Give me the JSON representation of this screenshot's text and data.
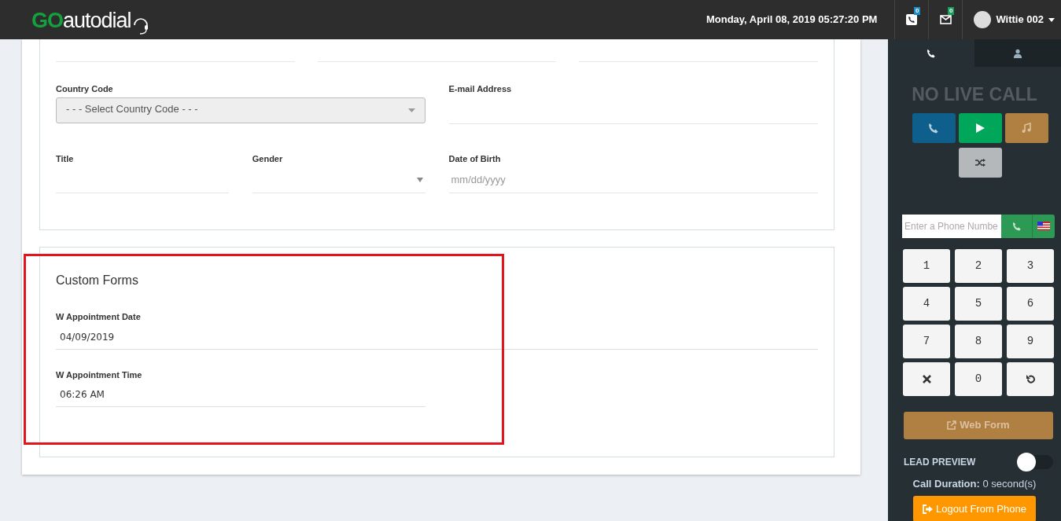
{
  "header": {
    "logo_go": "GO",
    "logo_rest": "autodial",
    "datetime": "Monday, April 08, 2019 05:27:20 PM",
    "calls_badge": "0",
    "messages_badge": "0",
    "user_name": "Wittie 002"
  },
  "contact_form": {
    "fields": [
      {
        "label": "Country Code",
        "kind": "select",
        "value": "- - - Select Country Code - - -"
      },
      {
        "label": "E-mail Address",
        "kind": "text"
      },
      {
        "label": "Title",
        "kind": "text"
      },
      {
        "label": "Gender",
        "kind": "dropdown"
      },
      {
        "label": "Date of Birth",
        "kind": "date",
        "placeholder": "mm/dd/yyyy"
      }
    ]
  },
  "custom_forms": {
    "title": "Custom Forms",
    "highlighted": true,
    "fields": [
      {
        "label": "W Appointment Date",
        "kind": "wide",
        "value": "04/09/2019"
      },
      {
        "label": "W Appointment Time",
        "kind": "half",
        "value": "06:26 AM"
      }
    ]
  },
  "dialer": {
    "tabs": [
      {
        "kind": "phone",
        "selected": true
      },
      {
        "kind": "person",
        "selected": false
      }
    ],
    "status": "NO LIVE CALL",
    "actions": [
      {
        "kind": "call"
      },
      {
        "kind": "play"
      },
      {
        "kind": "music"
      },
      {
        "kind": "shuffle"
      }
    ],
    "phone_input": {
      "placeholder": "Enter a Phone Numbe"
    },
    "keys": [
      {
        "kind": "digit",
        "label": "1"
      },
      {
        "kind": "digit",
        "label": "2"
      },
      {
        "kind": "digit",
        "label": "3"
      },
      {
        "kind": "digit",
        "label": "4"
      },
      {
        "kind": "digit",
        "label": "5"
      },
      {
        "kind": "digit",
        "label": "6"
      },
      {
        "kind": "digit",
        "label": "7"
      },
      {
        "kind": "digit",
        "label": "8"
      },
      {
        "kind": "digit",
        "label": "9"
      },
      {
        "kind": "clear"
      },
      {
        "kind": "digit",
        "label": "0"
      },
      {
        "kind": "undo"
      }
    ],
    "web_form": "Web Form",
    "lead_preview": {
      "label": "LEAD PREVIEW",
      "on": false
    },
    "call_duration": {
      "label": "Call Duration:",
      "value": "0 second(s)"
    },
    "logout": "Logout From Phone"
  }
}
